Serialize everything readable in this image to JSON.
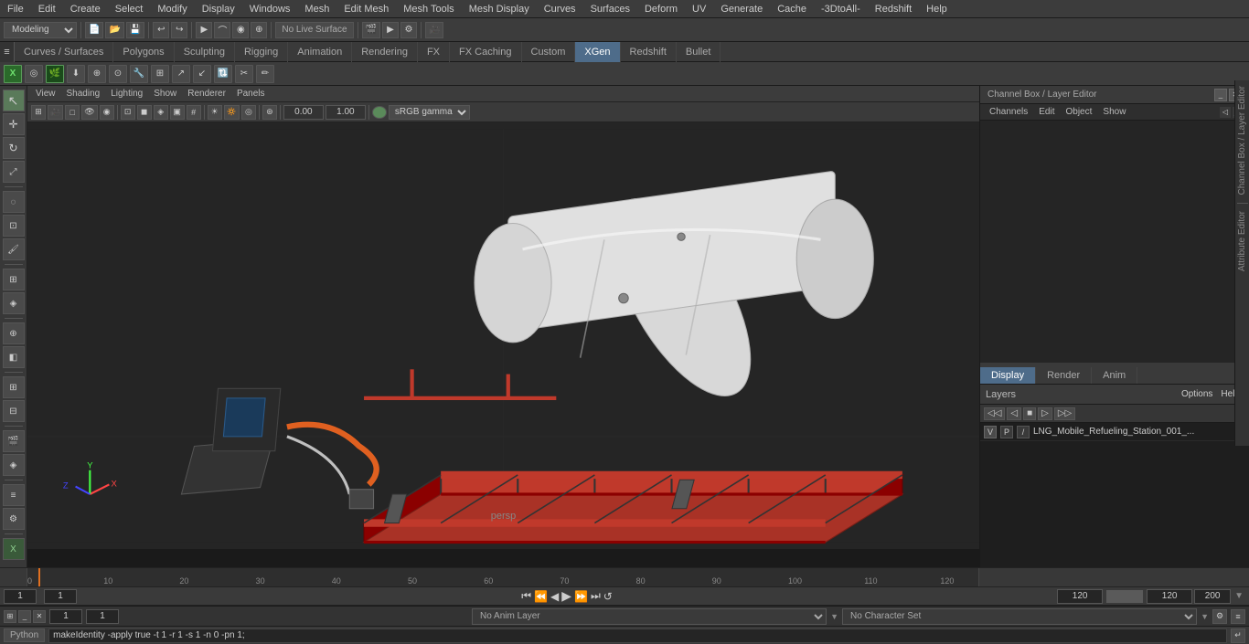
{
  "menubar": {
    "items": [
      "File",
      "Edit",
      "Create",
      "Select",
      "Modify",
      "Display",
      "Windows",
      "Mesh",
      "Edit Mesh",
      "Mesh Tools",
      "Mesh Display",
      "Curves",
      "Surfaces",
      "Deform",
      "UV",
      "Generate",
      "Cache",
      "-3DtoAll-",
      "Redshift",
      "Help"
    ]
  },
  "toolbar1": {
    "workspace_label": "Modeling",
    "live_surface": "No Live Surface"
  },
  "tabs": {
    "items": [
      "Curves / Surfaces",
      "Polygons",
      "Sculpting",
      "Rigging",
      "Animation",
      "Rendering",
      "FX",
      "FX Caching",
      "Custom",
      "XGen",
      "Redshift",
      "Bullet"
    ],
    "active": "XGen"
  },
  "viewport": {
    "menu_items": [
      "View",
      "Shading",
      "Lighting",
      "Show",
      "Renderer",
      "Panels"
    ],
    "camera_rotate": "0.00",
    "camera_scale": "1.00",
    "color_space": "sRGB gamma",
    "perspective_label": "persp"
  },
  "channel_box": {
    "title": "Channel Box / Layer Editor",
    "tabs": [
      "Channels",
      "Edit",
      "Object",
      "Show"
    ],
    "panel_tabs": [
      "Display",
      "Render",
      "Anim"
    ],
    "active_tab": "Display"
  },
  "layers": {
    "title": "Layers",
    "menu_items": [
      "Options",
      "Help"
    ],
    "layer_row": {
      "v": "V",
      "p": "P",
      "name": "LNG_Mobile_Refueling_Station_001_..."
    }
  },
  "timeline": {
    "ticks": [
      "0",
      "10",
      "20",
      "30",
      "40",
      "50",
      "60",
      "70",
      "80",
      "90",
      "100",
      "110",
      "120"
    ],
    "current_frame": "1",
    "start_frame": "1",
    "end_frame": "120",
    "range_start": "1",
    "range_end": "120",
    "total_frames": "200"
  },
  "playback": {
    "buttons": [
      "⏮",
      "⏪",
      "◀",
      "▶",
      "⏩",
      "⏭"
    ],
    "loop_btn": "↺"
  },
  "anim_layer": {
    "label": "No Anim Layer",
    "char_set_label": "No Character Set"
  },
  "script_bar": {
    "tab_label": "Python",
    "command": "makeIdentity -apply true -t 1 -r 1 -s 1 -n 0 -pn 1;"
  },
  "status": {
    "frame_value": "1",
    "frame_value2": "1"
  },
  "right_sidebar": {
    "items": [
      "Channel Box / Layer Editor",
      "Attribute Editor"
    ]
  }
}
